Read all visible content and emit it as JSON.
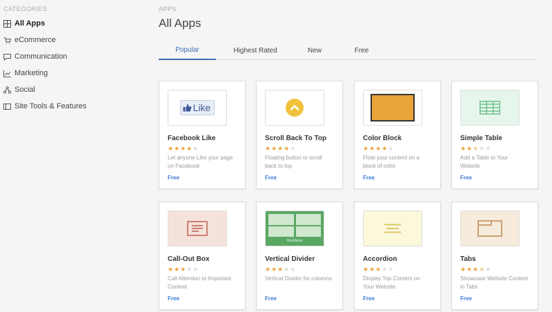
{
  "sidebar": {
    "heading": "CATEGORIES",
    "items": [
      {
        "label": "All Apps",
        "icon": "grid-icon",
        "active": true
      },
      {
        "label": "eCommerce",
        "icon": "cart-icon"
      },
      {
        "label": "Communication",
        "icon": "chat-icon"
      },
      {
        "label": "Marketing",
        "icon": "chart-icon"
      },
      {
        "label": "Social",
        "icon": "share-icon"
      },
      {
        "label": "Site Tools & Features",
        "icon": "tools-icon"
      }
    ]
  },
  "header": {
    "breadcrumb": "APPS",
    "title": "All Apps"
  },
  "tabs": [
    {
      "label": "Popular",
      "active": true
    },
    {
      "label": "Highest Rated"
    },
    {
      "label": "New"
    },
    {
      "label": "Free"
    }
  ],
  "colors": {
    "accent": "#3a6fb0",
    "star": "#e8a33a",
    "price": "#3a7bd5"
  },
  "apps": [
    {
      "name": "Facebook Like",
      "rating": 4,
      "desc": "Let anyone Like your page on Facebook",
      "price": "Free",
      "thumb_text": "Like",
      "icon": "facebook-like-icon"
    },
    {
      "name": "Scroll Back To Top",
      "rating": 4,
      "desc": "Floating button to scroll back to top",
      "price": "Free",
      "icon": "scroll-top-icon"
    },
    {
      "name": "Color Block",
      "rating": 4,
      "desc": "Float your content on a block of color",
      "price": "Free",
      "icon": "color-block-icon"
    },
    {
      "name": "Simple Table",
      "rating": 2.5,
      "desc": "Add a Table to Your Website",
      "price": "Free",
      "icon": "table-icon"
    },
    {
      "name": "Call-Out Box",
      "rating": 3,
      "desc": "Call Attention to Important Content",
      "price": "Free",
      "icon": "callout-icon"
    },
    {
      "name": "Vertical Divider",
      "rating": 3,
      "desc": "Vertical Divider for columns",
      "price": "Free",
      "thumb_text": "Waddame",
      "icon": "divider-icon"
    },
    {
      "name": "Accordion",
      "rating": 3,
      "desc": "Display Top Content on Your Website",
      "price": "Free",
      "icon": "accordion-icon"
    },
    {
      "name": "Tabs",
      "rating": 3.5,
      "desc": "Showcase Website Content in Tabs",
      "price": "Free",
      "icon": "tabs-icon"
    }
  ]
}
